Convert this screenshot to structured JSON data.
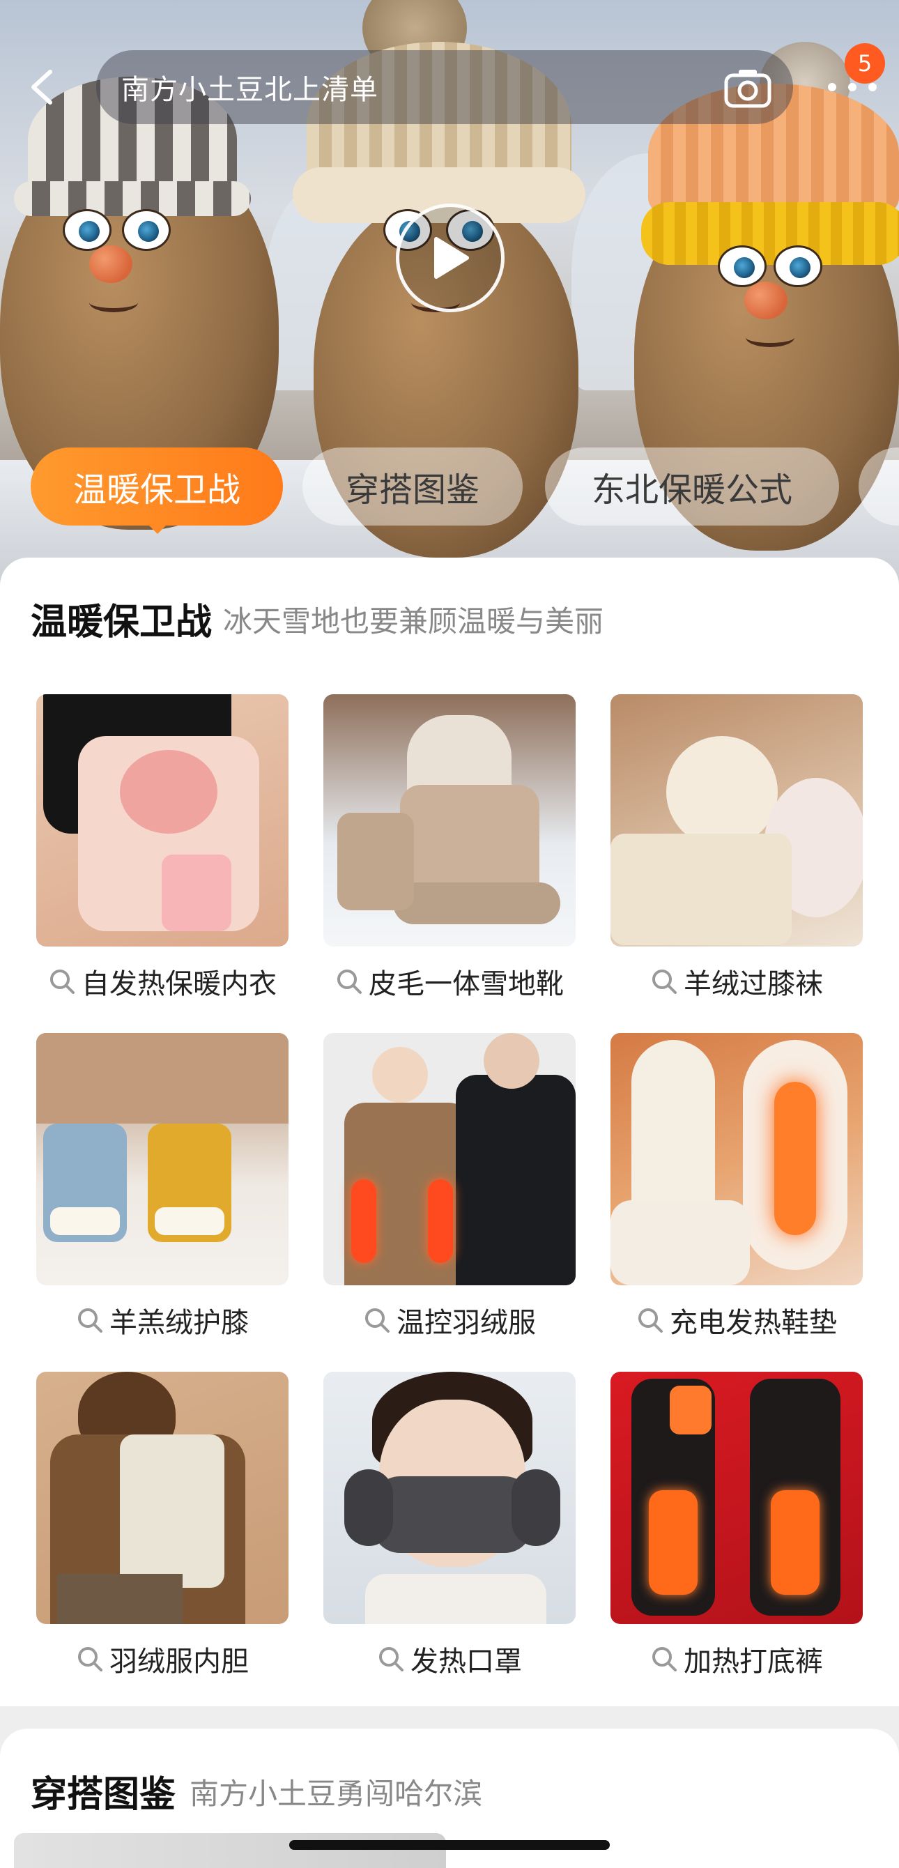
{
  "header": {
    "search_text": "南方小土豆北上清单",
    "notification_count": "5"
  },
  "tabs": [
    {
      "label": "温暖保卫战",
      "active": true
    },
    {
      "label": "穿搭图鉴",
      "active": false
    },
    {
      "label": "东北保暖公式",
      "active": false
    }
  ],
  "section1": {
    "title": "温暖保卫战",
    "subtitle": "冰天雪地也要兼顾温暖与美丽",
    "items": [
      {
        "label": "自发热保暖内衣"
      },
      {
        "label": "皮毛一体雪地靴"
      },
      {
        "label": "羊绒过膝袜"
      },
      {
        "label": "羊羔绒护膝"
      },
      {
        "label": "温控羽绒服"
      },
      {
        "label": "充电发热鞋垫"
      },
      {
        "label": "羽绒服内胆"
      },
      {
        "label": "发热口罩"
      },
      {
        "label": "加热打底裤"
      }
    ]
  },
  "section2": {
    "title": "穿搭图鉴",
    "subtitle": "南方小土豆勇闯哈尔滨"
  },
  "colors": {
    "accent_orange": "#ff8a24",
    "badge_red": "#ff5a1f"
  },
  "icons": {
    "back": "chevron-left-icon",
    "camera": "camera-icon",
    "more": "more-dots-icon",
    "play": "play-icon",
    "search": "search-icon"
  }
}
